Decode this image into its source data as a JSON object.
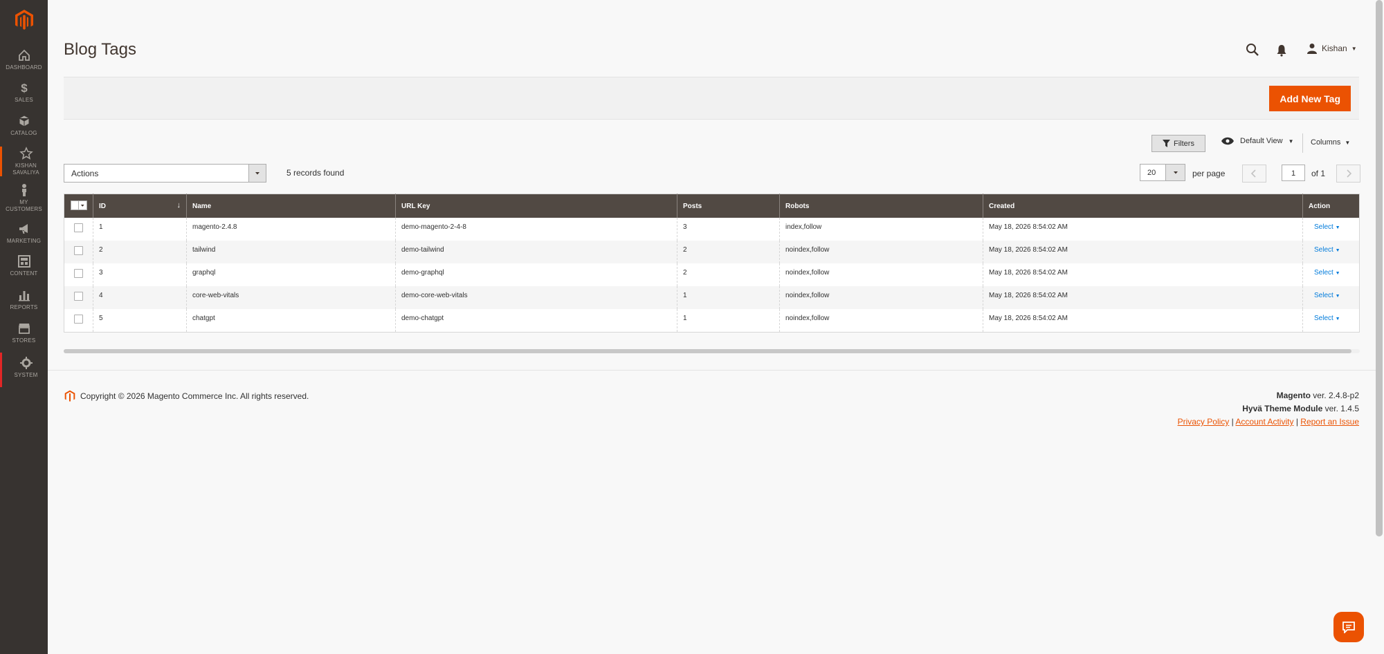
{
  "sidebar": {
    "items": [
      {
        "label": "DASHBOARD",
        "icon": "home-icon"
      },
      {
        "label": "SALES",
        "icon": "dollar-icon"
      },
      {
        "label": "CATALOG",
        "icon": "cube-icon"
      },
      {
        "label_line1": "KISHAN",
        "label_line2": "SAVALIYA",
        "icon": "star-icon"
      },
      {
        "label_line1": "MY",
        "label_line2": "CUSTOMERS",
        "icon": "person-icon"
      },
      {
        "label": "MARKETING",
        "icon": "megaphone-icon"
      },
      {
        "label": "CONTENT",
        "icon": "layout-icon"
      },
      {
        "label": "REPORTS",
        "icon": "bar-chart-icon"
      },
      {
        "label": "STORES",
        "icon": "storefront-icon"
      },
      {
        "label": "SYSTEM",
        "icon": "gear-icon"
      }
    ]
  },
  "header": {
    "title": "Blog Tags",
    "user": "Kishan"
  },
  "action_bar": {
    "add_label": "Add New Tag"
  },
  "grid_controls": {
    "filters_label": "Filters",
    "view_label": "Default View",
    "columns_label": "Columns",
    "actions_label": "Actions",
    "records_found": "5 records found",
    "per_page_value": "20",
    "per_page_label": "per page",
    "page_value": "1",
    "page_of": "of 1"
  },
  "table": {
    "columns": [
      "ID",
      "Name",
      "URL Key",
      "Posts",
      "Robots",
      "Created",
      "Action"
    ],
    "rows": [
      {
        "id": "1",
        "name": "magento-2.4.8",
        "url_key": "demo-magento-2-4-8",
        "posts": "3",
        "robots": "index,follow",
        "created": "May 18, 2026 8:54:02 AM",
        "action": "Select"
      },
      {
        "id": "2",
        "name": "tailwind",
        "url_key": "demo-tailwind",
        "posts": "2",
        "robots": "noindex,follow",
        "created": "May 18, 2026 8:54:02 AM",
        "action": "Select"
      },
      {
        "id": "3",
        "name": "graphql",
        "url_key": "demo-graphql",
        "posts": "2",
        "robots": "noindex,follow",
        "created": "May 18, 2026 8:54:02 AM",
        "action": "Select"
      },
      {
        "id": "4",
        "name": "core-web-vitals",
        "url_key": "demo-core-web-vitals",
        "posts": "1",
        "robots": "noindex,follow",
        "created": "May 18, 2026 8:54:02 AM",
        "action": "Select"
      },
      {
        "id": "5",
        "name": "chatgpt",
        "url_key": "demo-chatgpt",
        "posts": "1",
        "robots": "noindex,follow",
        "created": "May 18, 2026 8:54:02 AM",
        "action": "Select"
      }
    ]
  },
  "footer": {
    "copyright": "Copyright © 2026 Magento Commerce Inc. All rights reserved.",
    "magento_name": "Magento",
    "magento_ver": "ver. 2.4.8-p2",
    "hyva_name": "Hyvä Theme Module",
    "hyva_ver": "ver. 1.4.5",
    "privacy": "Privacy Policy",
    "account_activity": "Account Activity",
    "report_issue": "Report an Issue",
    "separator": "|"
  },
  "colors": {
    "accent": "#eb5202",
    "sidebar_bg": "#373330",
    "table_header": "#514943",
    "link": "#007bdb"
  }
}
